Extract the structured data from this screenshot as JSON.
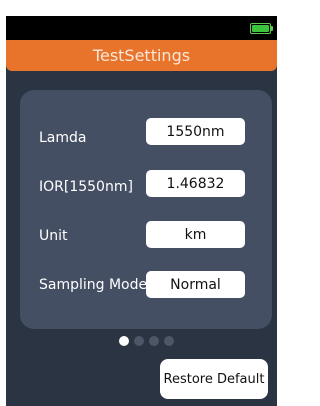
{
  "statusbar": {
    "battery_icon": "battery-full-icon",
    "battery_color": "#3cc43c"
  },
  "header": {
    "title": "TestSettings",
    "accent_color": "#e8732b"
  },
  "settings": {
    "rows": [
      {
        "label": "Lamda",
        "value": "1550nm"
      },
      {
        "label": "IOR[1550nm]",
        "value": "1.46832"
      },
      {
        "label": "Unit",
        "value": "km"
      },
      {
        "label": "Sampling Mode",
        "value": "Normal"
      }
    ]
  },
  "pager": {
    "pages": 4,
    "current": 1
  },
  "actions": {
    "restore_label": "Restore Default"
  }
}
